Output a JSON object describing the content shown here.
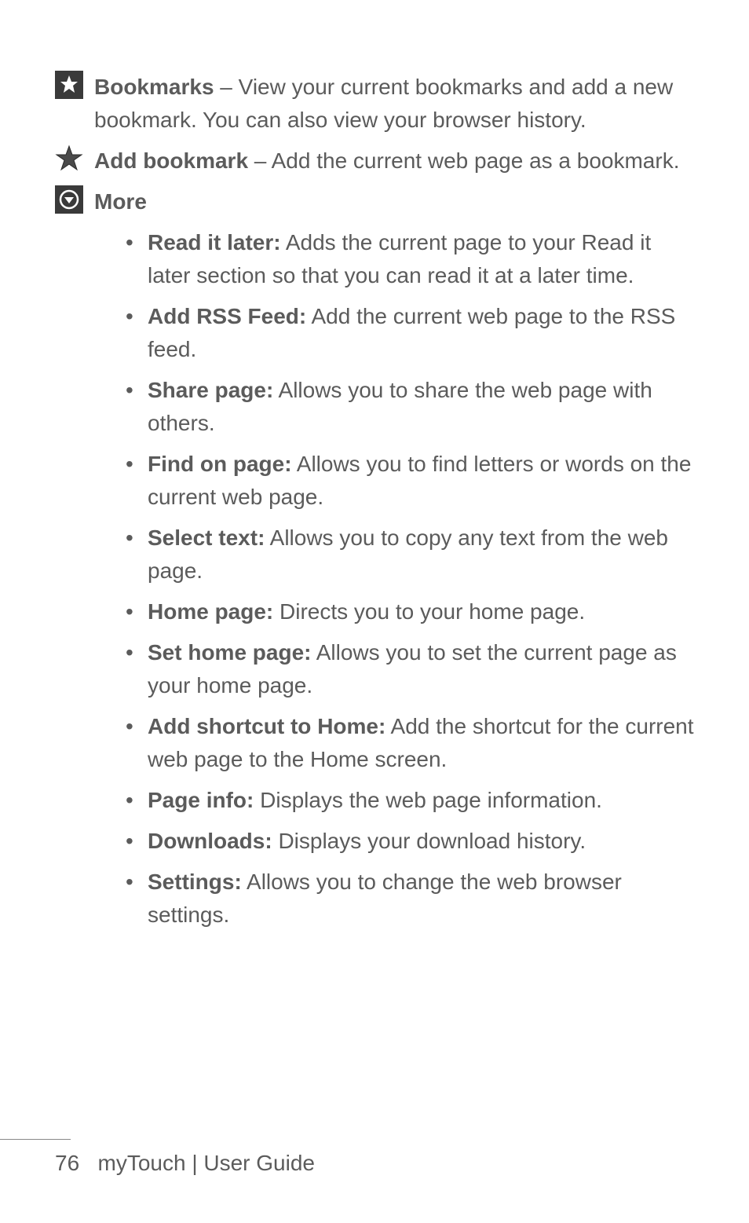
{
  "entries": {
    "bookmarks": {
      "label": "Bookmarks",
      "sep": " – ",
      "desc": "View your current bookmarks and add a new bookmark. You can also view your browser history."
    },
    "addbookmark": {
      "label": "Add bookmark",
      "sep": " – ",
      "desc": "Add the current web page as a bookmark."
    },
    "more": {
      "label": "More"
    }
  },
  "more_items": [
    {
      "label": "Read it later:",
      "desc": " Adds the current page to your Read it later section so that you can read it at a later time."
    },
    {
      "label": "Add RSS Feed:",
      "desc": " Add the current web page to the RSS feed."
    },
    {
      "label": "Share page:",
      "desc": " Allows you to share the web page with others."
    },
    {
      "label": "Find on page:",
      "desc": " Allows you to find letters or words on the current web page."
    },
    {
      "label": "Select text:",
      "desc": " Allows you to copy any text from the web page."
    },
    {
      "label": "Home page:",
      "desc": " Directs you to your home page."
    },
    {
      "label": "Set home page:",
      "desc": " Allows you to set the current page as your home page."
    },
    {
      "label": "Add shortcut to Home:",
      "desc": " Add the shortcut for the current web page to the Home screen."
    },
    {
      "label": "Page info:",
      "desc": " Displays the web page information."
    },
    {
      "label": "Downloads:",
      "desc": " Displays your download history."
    },
    {
      "label": "Settings:",
      "desc": " Allows you to change the web browser settings."
    }
  ],
  "footer": {
    "page": "76",
    "title": "myTouch  |  User Guide"
  }
}
